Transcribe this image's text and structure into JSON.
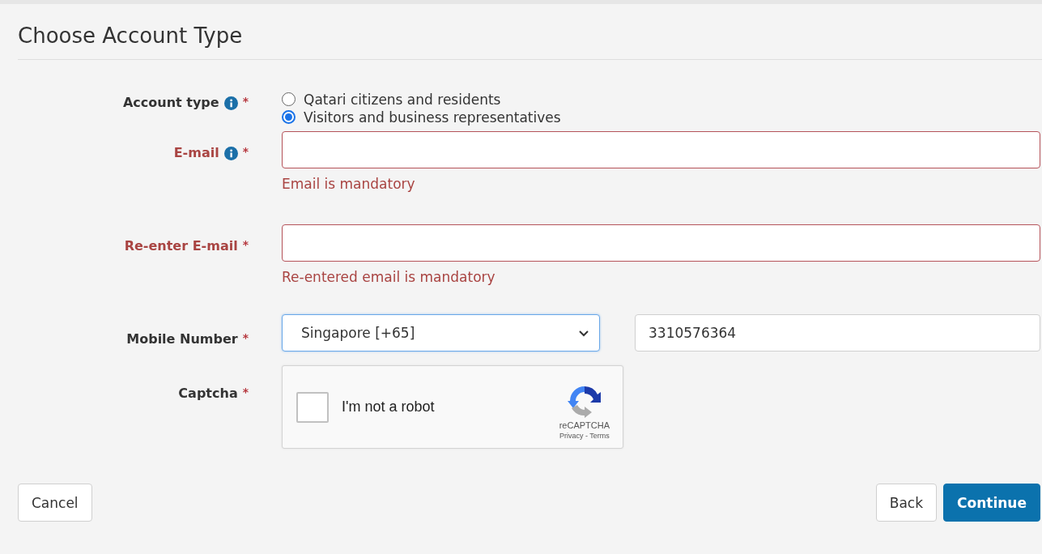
{
  "title": "Choose Account Type",
  "fields": [
    {
      "kind": "radio",
      "label": "Account type",
      "info": true,
      "required": "*",
      "invalid": false,
      "options": [
        {
          "label": "Qatari citizens and residents",
          "selected": false
        },
        {
          "label": "Visitors and business representatives",
          "selected": true
        }
      ]
    },
    {
      "kind": "text",
      "label": "E-mail",
      "info": true,
      "required": "*",
      "invalid": true,
      "error": "Email is mandatory"
    },
    {
      "kind": "text",
      "label": "Re-enter E-mail",
      "info": false,
      "required": "*",
      "invalid": true,
      "error": "Re-entered email is mandatory"
    },
    {
      "kind": "phone",
      "label": "Mobile Number",
      "info": false,
      "required": "*",
      "invalid": false,
      "country": "Singapore [+65]",
      "focused": true,
      "value": "3310576364"
    },
    {
      "kind": "captcha",
      "label": "Captcha",
      "info": false,
      "required": "*",
      "invalid": false,
      "checked": false,
      "text": "I'm not a robot",
      "brand": "reCAPTCHA",
      "links": "Privacy - Terms"
    }
  ],
  "left_buttons": [
    {
      "label": "Cancel",
      "primary": false
    }
  ],
  "right_buttons": [
    {
      "label": "Back",
      "primary": false
    },
    {
      "label": "Continue",
      "primary": true
    }
  ]
}
